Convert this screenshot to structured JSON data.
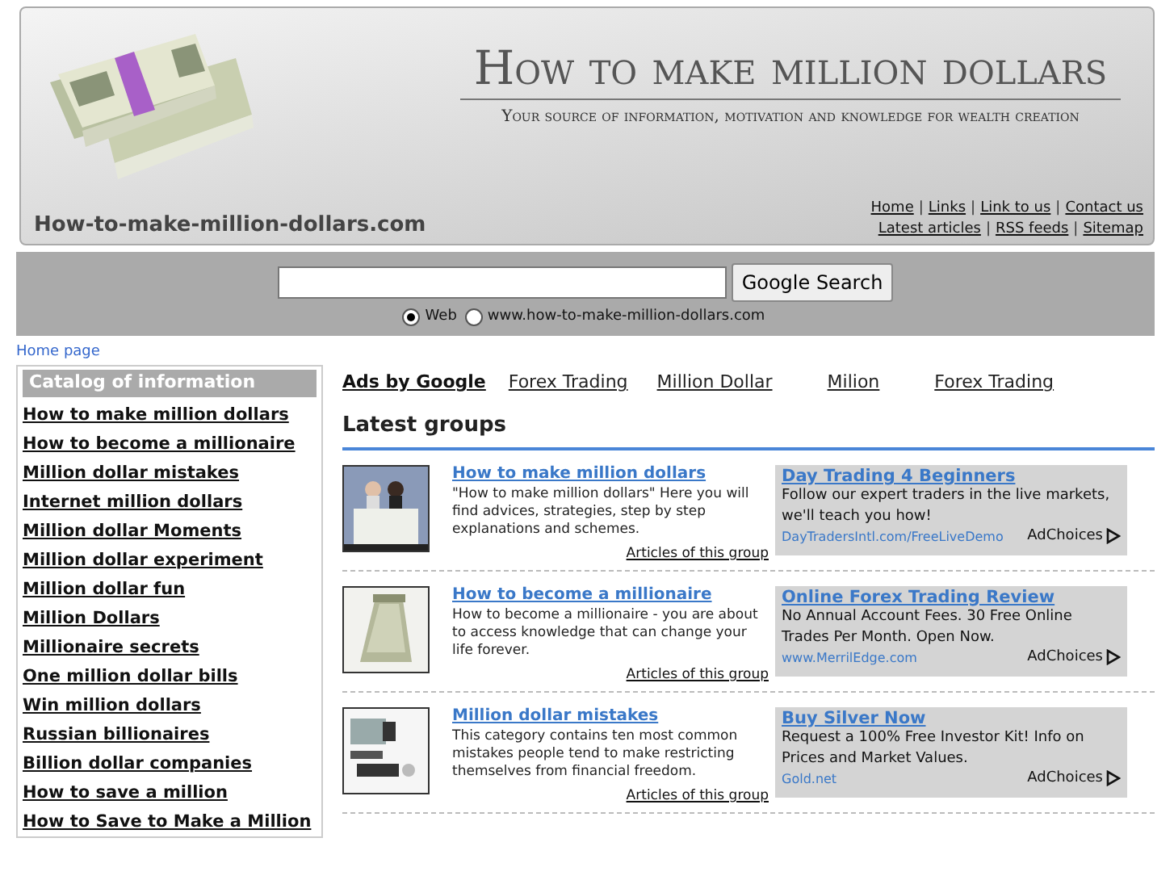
{
  "header": {
    "title": "How to make million dollars",
    "tagline": "Your source of information, motivation and knowledge for wealth creation",
    "domain": "How-to-make-million-dollars.com",
    "nav_separator": "|",
    "nav_rows": [
      [
        "Home",
        "Links",
        "Link to us",
        "Contact us"
      ],
      [
        "Latest articles",
        "RSS feeds",
        "Sitemap"
      ]
    ]
  },
  "search": {
    "button": "Google Search",
    "options": [
      {
        "label": "Web",
        "selected": true
      },
      {
        "label": "www.how-to-make-million-dollars.com",
        "selected": false
      }
    ]
  },
  "breadcrumb": "Home page",
  "sidebar": {
    "title": "Catalog of information",
    "items": [
      "How to make million dollars",
      "How to become a millionaire",
      "Million dollar mistakes",
      "Internet million dollars",
      "Million dollar Moments",
      "Million dollar experiment",
      "Million dollar fun",
      "Million Dollars",
      "Millionaire secrets",
      "One million dollar bills",
      "Win million dollars",
      "Russian billionaires",
      "Billion dollar companies",
      "How to save a million",
      "How to Save to Make a Million"
    ]
  },
  "ad_links": {
    "label": "Ads by Google",
    "links": [
      "Forex Trading",
      "Million Dollar",
      "Milion",
      "Forex Trading"
    ]
  },
  "latest_groups": {
    "title": "Latest groups",
    "groups": [
      {
        "kind": "picture",
        "title": "How to make million dollars",
        "text": "\"How to make million dollars\" Here you will find advices, strategies, step by step explanations and schemes.",
        "more": "Articles of this group",
        "ad": {
          "title": "Day Trading 4 Beginners",
          "text": "Follow our expert traders in the live markets, we'll teach you how!",
          "url": "DayTradersIntl.com/FreeLiveDemo",
          "choices": "AdChoices"
        }
      },
      {
        "kind": "picture",
        "title": "How to become a millionaire",
        "text": "How to become a millionaire - you are about to access knowledge that can change your life forever.",
        "more": "Articles of this group",
        "ad": {
          "title": "Online Forex Trading Review",
          "text": "No Annual Account Fees. 30 Free Online Trades Per Month. Open Now.",
          "url": "www.MerrilEdge.com",
          "choices": "AdChoices"
        }
      },
      {
        "kind": "picture",
        "title": "Million dollar mistakes",
        "text": "This category contains ten most common mistakes people tend to make restricting themselves from financial freedom.",
        "more": "Articles of this group",
        "ad": {
          "title": "Buy Silver Now",
          "text": "Request a 100% Free Investor Kit! Info on Prices and Market Values.",
          "url": "Gold.net",
          "choices": "AdChoices"
        }
      }
    ]
  }
}
